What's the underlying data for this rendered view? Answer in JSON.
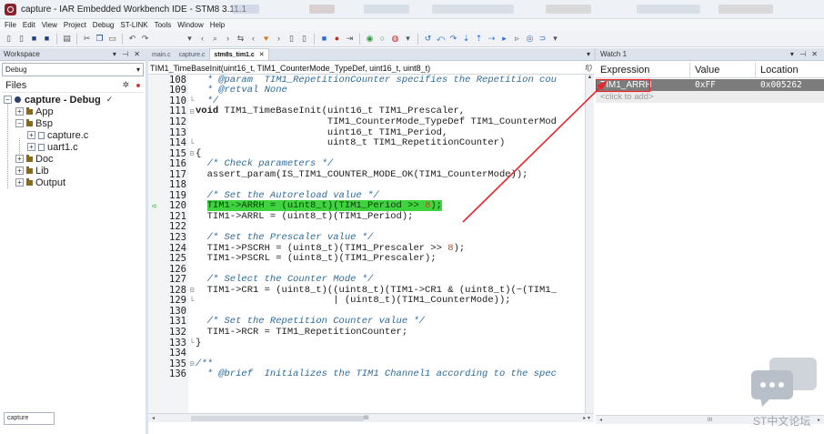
{
  "window": {
    "title": "capture - IAR Embedded Workbench IDE - STM8 3.11.1"
  },
  "menu": [
    "File",
    "Edit",
    "View",
    "Project",
    "Debug",
    "ST-LINK",
    "Tools",
    "Window",
    "Help"
  ],
  "workspace": {
    "header": "Workspace",
    "controls": "▾ ⊣ ✕",
    "config": "Debug",
    "files_label": "Files",
    "tree": [
      {
        "label": "capture - Debug",
        "level": 0,
        "kind": "project",
        "checked": true
      },
      {
        "label": "App",
        "level": 1,
        "kind": "folder"
      },
      {
        "label": "Bsp",
        "level": 1,
        "kind": "folder",
        "expanded": true
      },
      {
        "label": "capture.c",
        "level": 2,
        "kind": "file"
      },
      {
        "label": "uart1.c",
        "level": 2,
        "kind": "file"
      },
      {
        "label": "Doc",
        "level": 1,
        "kind": "folder"
      },
      {
        "label": "Lib",
        "level": 1,
        "kind": "folder"
      },
      {
        "label": "Output",
        "level": 1,
        "kind": "folder"
      }
    ],
    "bottom_tab": "capture"
  },
  "editor": {
    "tabs": [
      {
        "label": "main.c",
        "active": false
      },
      {
        "label": "capture.c",
        "active": false
      },
      {
        "label": "stm8s_tim1.c",
        "active": true
      }
    ],
    "function_signature": "TIM1_TimeBaseInit(uint16_t, TIM1_CounterMode_TypeDef, uint16_t, uint8_t)",
    "function_marker": "f()",
    "current_line": 120,
    "lines": [
      {
        "n": 108,
        "text": "  * @param  TIM1_RepetitionCounter specifies the Repetition cou",
        "style": "comment"
      },
      {
        "n": 109,
        "text": "  * @retval None",
        "style": "comment"
      },
      {
        "n": 110,
        "text": "  */",
        "style": "comment"
      },
      {
        "n": 111,
        "text": "void TIM1_TimeBaseInit(uint16_t TIM1_Prescaler,",
        "style": "decl"
      },
      {
        "n": 112,
        "text": "                       TIM1_CounterMode_TypeDef TIM1_CounterMod",
        "style": "plain"
      },
      {
        "n": 113,
        "text": "                       uint16_t TIM1_Period,",
        "style": "plain"
      },
      {
        "n": 114,
        "text": "                       uint8_t TIM1_RepetitionCounter)",
        "style": "plain"
      },
      {
        "n": 115,
        "text": "{",
        "style": "plain"
      },
      {
        "n": 116,
        "text": "  /* Check parameters */",
        "style": "comment"
      },
      {
        "n": 117,
        "text": "  assert_param(IS_TIM1_COUNTER_MODE_OK(TIM1_CounterMode));",
        "style": "plain"
      },
      {
        "n": 118,
        "text": "",
        "style": "plain"
      },
      {
        "n": 119,
        "text": "  /* Set the Autoreload value */",
        "style": "comment"
      },
      {
        "n": 120,
        "text": "  TIM1->ARRH = (uint8_t)(TIM1_Period >> 8);",
        "style": "current"
      },
      {
        "n": 121,
        "text": "  TIM1->ARRL = (uint8_t)(TIM1_Period);",
        "style": "plain"
      },
      {
        "n": 122,
        "text": "",
        "style": "plain"
      },
      {
        "n": 123,
        "text": "  /* Set the Prescaler value */",
        "style": "comment"
      },
      {
        "n": 124,
        "text": "  TIM1->PSCRH = (uint8_t)(TIM1_Prescaler >> 8);",
        "style": "num8"
      },
      {
        "n": 125,
        "text": "  TIM1->PSCRL = (uint8_t)(TIM1_Prescaler);",
        "style": "plain"
      },
      {
        "n": 126,
        "text": "",
        "style": "plain"
      },
      {
        "n": 127,
        "text": "  /* Select the Counter Mode */",
        "style": "comment"
      },
      {
        "n": 128,
        "text": "  TIM1->CR1 = (uint8_t)((uint8_t)(TIM1->CR1 & (uint8_t)(~(TIM1_",
        "style": "plain"
      },
      {
        "n": 129,
        "text": "                        | (uint8_t)(TIM1_CounterMode));",
        "style": "plain"
      },
      {
        "n": 130,
        "text": "",
        "style": "plain"
      },
      {
        "n": 131,
        "text": "  /* Set the Repetition Counter value */",
        "style": "comment"
      },
      {
        "n": 132,
        "text": "  TIM1->RCR = TIM1_RepetitionCounter;",
        "style": "plain"
      },
      {
        "n": 133,
        "text": "}",
        "style": "plain"
      },
      {
        "n": 134,
        "text": "",
        "style": "plain"
      },
      {
        "n": 135,
        "text": "/**",
        "style": "comment"
      },
      {
        "n": 136,
        "text": "  * @brief  Initializes the TIM1 Channel1 according to the spec",
        "style": "comment"
      }
    ],
    "h_scroll_label": "III"
  },
  "watch": {
    "title": "Watch 1",
    "controls": "▾ ⊣ ✕",
    "columns": [
      "Expression",
      "Value",
      "Location"
    ],
    "rows": [
      {
        "expression": "TIM1_ARRH",
        "value": "0xFF",
        "location": "0x005262"
      }
    ],
    "add_placeholder": "<click to add>",
    "h_scroll_label": "III"
  },
  "watermark": {
    "text": "ST中文论坛"
  },
  "colors": {
    "highlight": "#3fd33f",
    "annotation": "#e8262c",
    "selected_row": "#7c7c7c"
  }
}
